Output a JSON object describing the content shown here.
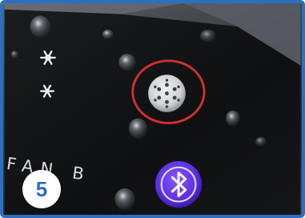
{
  "photo": {
    "description_label": "",
    "highlight_color": "#d32f2f",
    "frame_color": "#2b6fc1"
  },
  "labels": {
    "fan_text": "FAN B"
  },
  "badge": {
    "step_number": "5"
  },
  "icons": [
    "snowflake-icon",
    "bluetooth-icon",
    "fan-icon"
  ]
}
